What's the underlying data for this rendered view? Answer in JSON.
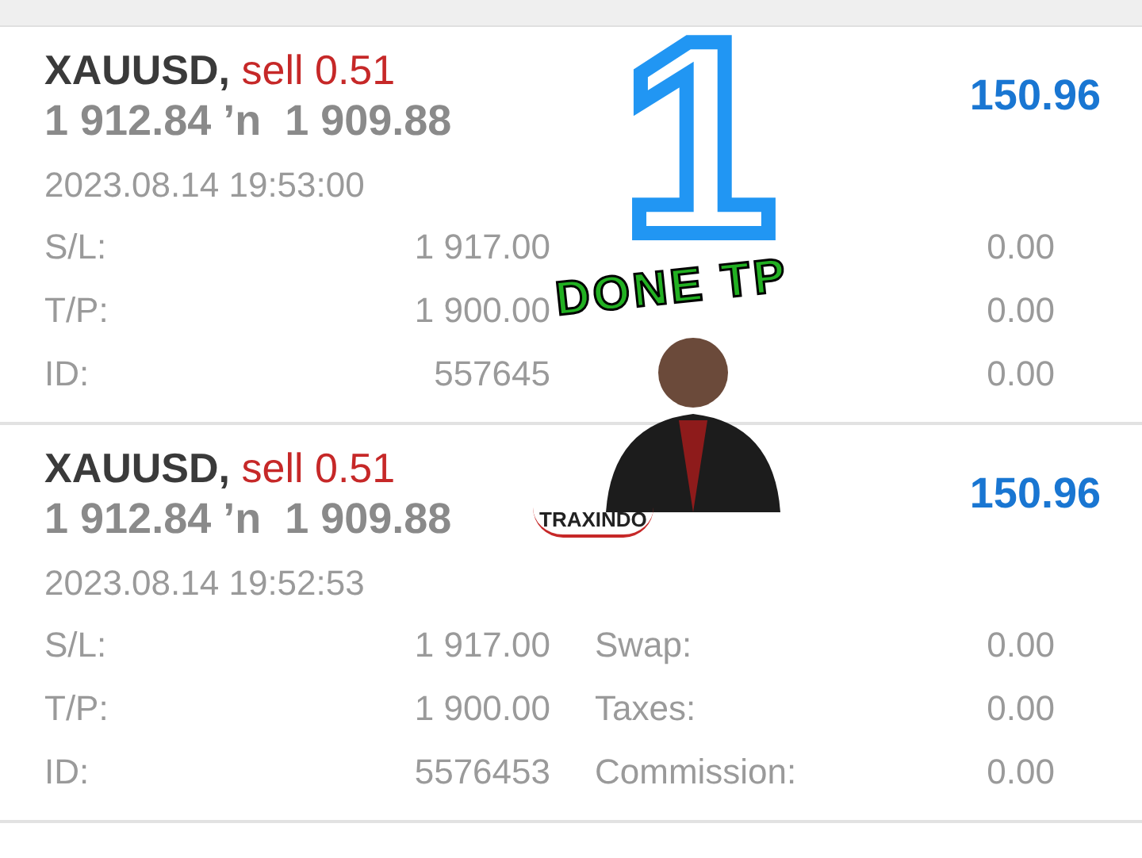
{
  "trades": [
    {
      "symbol": "XAUUSD,",
      "side": "sell 0.51",
      "prices": "1 912.84 ’n  1 909.88",
      "profit": "150.96",
      "time": "2023.08.14 19:53:00",
      "details": [
        {
          "label": "S/L:",
          "value": "1 917.00",
          "value_2": "0.00"
        },
        {
          "label": "T/P:",
          "value": "1 900.00",
          "value_2": "0.00"
        },
        {
          "label": "ID:",
          "value": "557645",
          "value_2": "0.00"
        }
      ]
    },
    {
      "symbol": "XAUUSD,",
      "side": "sell 0.51",
      "prices": "1 912.84 ’n  1 909.88",
      "profit": "150.96",
      "time": "2023.08.14 19:52:53",
      "details": [
        {
          "label": "S/L:",
          "value": "1 917.00",
          "label_2": "Swap:",
          "value_2": "0.00"
        },
        {
          "label": "T/P:",
          "value": "1 900.00",
          "label_2": "Taxes:",
          "value_2": "0.00"
        },
        {
          "label": "ID:",
          "value": "5576453",
          "label_2": "Commission:",
          "value_2": "0.00"
        }
      ]
    }
  ],
  "sticker": {
    "numeral": "1",
    "caption": "DONE TP",
    "logo": "TRAXINDO"
  }
}
